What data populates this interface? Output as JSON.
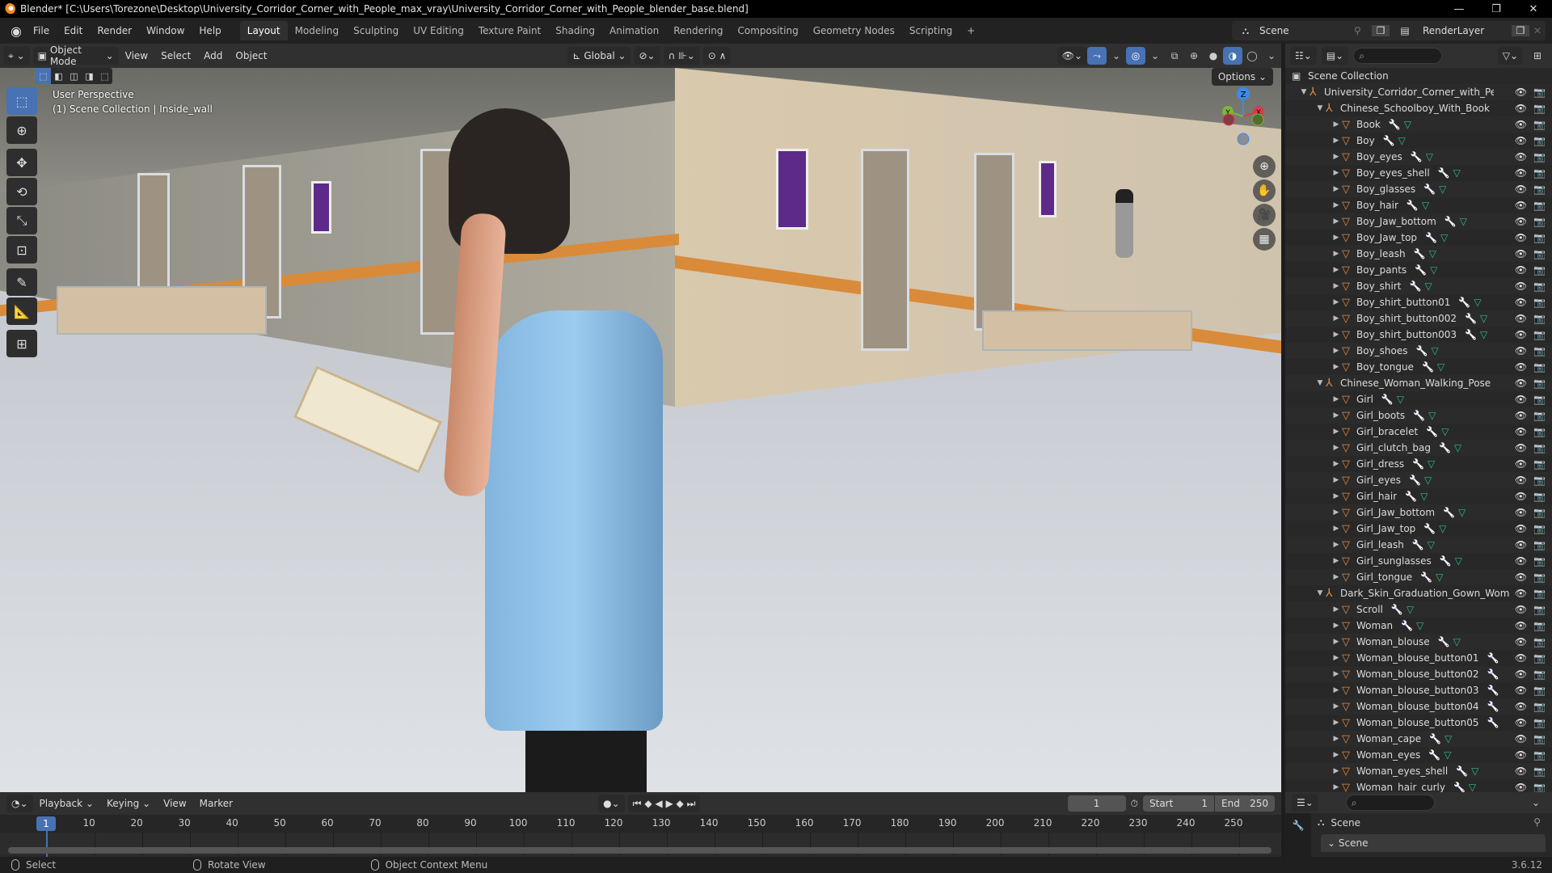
{
  "window": {
    "title": "Blender* [C:\\Users\\Torezone\\Desktop\\University_Corridor_Corner_with_People_max_vray\\University_Corridor_Corner_with_People_blender_base.blend]",
    "minimize": "—",
    "maximize": "❐",
    "close": "✕"
  },
  "menus": [
    "File",
    "Edit",
    "Render",
    "Window",
    "Help"
  ],
  "workspaces": [
    "Layout",
    "Modeling",
    "Sculpting",
    "UV Editing",
    "Texture Paint",
    "Shading",
    "Animation",
    "Rendering",
    "Compositing",
    "Geometry Nodes",
    "Scripting",
    "+"
  ],
  "active_workspace": "Layout",
  "scene_selector": {
    "value": "Scene"
  },
  "view_layer_selector": {
    "value": "RenderLayer"
  },
  "viewport_header": {
    "mode": "Object Mode",
    "menus": [
      "View",
      "Select",
      "Add",
      "Object"
    ],
    "orientation": "Global",
    "options": "Options"
  },
  "viewport": {
    "perspective": "User Perspective",
    "context": "(1) Scene Collection | Inside_wall",
    "gizmo": {
      "z": "Z",
      "y": "Y",
      "x": "X"
    },
    "accent": "#4772b3"
  },
  "tools": [
    "select-box",
    "cursor",
    "move",
    "rotate",
    "scale",
    "transform",
    "annotate",
    "measure",
    "add-cube"
  ],
  "outliner": {
    "root": "Scene Collection",
    "items": [
      {
        "level": 1,
        "type": "collection",
        "name": "University_Corridor_Corner_with_People",
        "expanded": true
      },
      {
        "level": 2,
        "type": "collection",
        "name": "Chinese_Schoolboy_With_Book",
        "expanded": true
      },
      {
        "level": 3,
        "type": "mesh",
        "name": "Book",
        "mod": true,
        "data": true
      },
      {
        "level": 3,
        "type": "mesh",
        "name": "Boy",
        "mod": true,
        "data": true
      },
      {
        "level": 3,
        "type": "mesh",
        "name": "Boy_eyes",
        "mod": true,
        "data": true
      },
      {
        "level": 3,
        "type": "mesh",
        "name": "Boy_eyes_shell",
        "mod": true,
        "data": true
      },
      {
        "level": 3,
        "type": "mesh",
        "name": "Boy_glasses",
        "mod": true,
        "data": true
      },
      {
        "level": 3,
        "type": "mesh",
        "name": "Boy_hair",
        "mod": true,
        "data": true
      },
      {
        "level": 3,
        "type": "mesh",
        "name": "Boy_Jaw_bottom",
        "mod": true,
        "data": true
      },
      {
        "level": 3,
        "type": "mesh",
        "name": "Boy_Jaw_top",
        "mod": true,
        "data": true
      },
      {
        "level": 3,
        "type": "mesh",
        "name": "Boy_leash",
        "mod": true,
        "data": true
      },
      {
        "level": 3,
        "type": "mesh",
        "name": "Boy_pants",
        "mod": true,
        "data": true
      },
      {
        "level": 3,
        "type": "mesh",
        "name": "Boy_shirt",
        "mod": true,
        "data": true
      },
      {
        "level": 3,
        "type": "mesh",
        "name": "Boy_shirt_button01",
        "mod": true,
        "data": true
      },
      {
        "level": 3,
        "type": "mesh",
        "name": "Boy_shirt_button002",
        "mod": true,
        "data": true
      },
      {
        "level": 3,
        "type": "mesh",
        "name": "Boy_shirt_button003",
        "mod": true,
        "data": true
      },
      {
        "level": 3,
        "type": "mesh",
        "name": "Boy_shoes",
        "mod": true,
        "data": true
      },
      {
        "level": 3,
        "type": "mesh",
        "name": "Boy_tongue",
        "mod": true,
        "data": true
      },
      {
        "level": 2,
        "type": "collection",
        "name": "Chinese_Woman_Walking_Pose",
        "expanded": true
      },
      {
        "level": 3,
        "type": "mesh",
        "name": "Girl",
        "mod": true,
        "data": true
      },
      {
        "level": 3,
        "type": "mesh",
        "name": "Girl_boots",
        "mod": true,
        "data": true
      },
      {
        "level": 3,
        "type": "mesh",
        "name": "Girl_bracelet",
        "mod": true,
        "data": true
      },
      {
        "level": 3,
        "type": "mesh",
        "name": "Girl_clutch_bag",
        "mod": true,
        "data": true
      },
      {
        "level": 3,
        "type": "mesh",
        "name": "Girl_dress",
        "mod": true,
        "data": true
      },
      {
        "level": 3,
        "type": "mesh",
        "name": "Girl_eyes",
        "mod": true,
        "data": true
      },
      {
        "level": 3,
        "type": "mesh",
        "name": "Girl_hair",
        "mod": true,
        "data": true
      },
      {
        "level": 3,
        "type": "mesh",
        "name": "Girl_Jaw_bottom",
        "mod": true,
        "data": true
      },
      {
        "level": 3,
        "type": "mesh",
        "name": "Girl_Jaw_top",
        "mod": true,
        "data": true
      },
      {
        "level": 3,
        "type": "mesh",
        "name": "Girl_leash",
        "mod": true,
        "data": true
      },
      {
        "level": 3,
        "type": "mesh",
        "name": "Girl_sunglasses",
        "mod": true,
        "data": true
      },
      {
        "level": 3,
        "type": "mesh",
        "name": "Girl_tongue",
        "mod": true,
        "data": true
      },
      {
        "level": 2,
        "type": "collection",
        "name": "Dark_Skin_Graduation_Gown_Woma",
        "expanded": true
      },
      {
        "level": 3,
        "type": "mesh",
        "name": "Scroll",
        "mod": true,
        "data": true
      },
      {
        "level": 3,
        "type": "mesh",
        "name": "Woman",
        "mod": true,
        "data": true
      },
      {
        "level": 3,
        "type": "mesh",
        "name": "Woman_blouse",
        "mod": true,
        "data": true
      },
      {
        "level": 3,
        "type": "mesh",
        "name": "Woman_blouse_button01",
        "mod": true,
        "data": false
      },
      {
        "level": 3,
        "type": "mesh",
        "name": "Woman_blouse_button02",
        "mod": true,
        "data": false
      },
      {
        "level": 3,
        "type": "mesh",
        "name": "Woman_blouse_button03",
        "mod": true,
        "data": false
      },
      {
        "level": 3,
        "type": "mesh",
        "name": "Woman_blouse_button04",
        "mod": true,
        "data": false
      },
      {
        "level": 3,
        "type": "mesh",
        "name": "Woman_blouse_button05",
        "mod": true,
        "data": false
      },
      {
        "level": 3,
        "type": "mesh",
        "name": "Woman_cape",
        "mod": true,
        "data": true
      },
      {
        "level": 3,
        "type": "mesh",
        "name": "Woman_eyes",
        "mod": true,
        "data": true
      },
      {
        "level": 3,
        "type": "mesh",
        "name": "Woman_eyes_shell",
        "mod": true,
        "data": true
      },
      {
        "level": 3,
        "type": "mesh",
        "name": "Woman_hair_curly",
        "mod": true,
        "data": true
      }
    ]
  },
  "timeline": {
    "menus": [
      "Playback",
      "Keying",
      "View",
      "Marker"
    ],
    "current_frame": "1",
    "start_label": "Start",
    "start": "1",
    "end_label": "End",
    "end": "250",
    "ticks": [
      "10",
      "20",
      "30",
      "40",
      "50",
      "60",
      "70",
      "80",
      "90",
      "100",
      "110",
      "120",
      "130",
      "140",
      "150",
      "160",
      "170",
      "180",
      "190",
      "200",
      "210",
      "220",
      "230",
      "240",
      "250"
    ]
  },
  "properties": {
    "scene_label": "Scene",
    "panel_label": "Scene"
  },
  "statusbar": {
    "select": "Select",
    "rotate": "Rotate View",
    "context": "Object Context Menu",
    "version": "3.6.12"
  }
}
